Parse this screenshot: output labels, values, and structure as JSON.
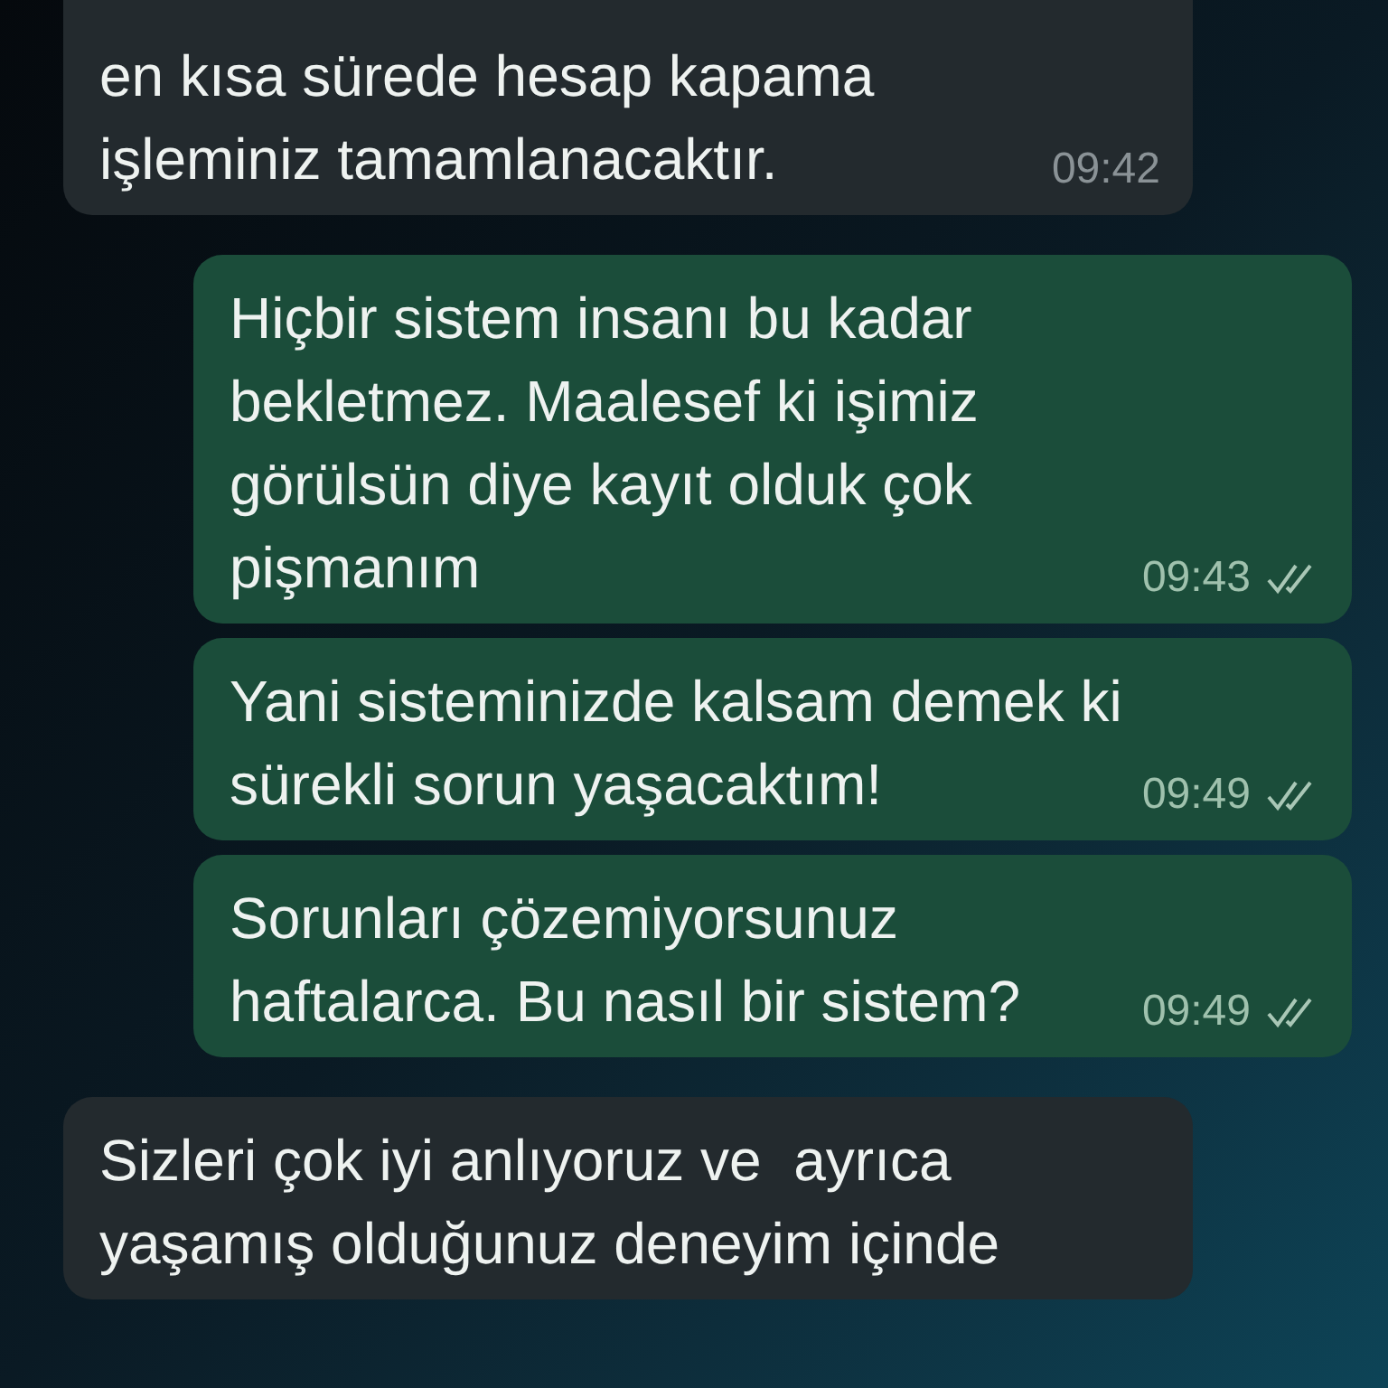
{
  "messages": [
    {
      "kind": "incoming",
      "text": "en kısa sürede hesap kapama\nişleminiz tamamlanacaktır.",
      "time": "09:42"
    },
    {
      "kind": "outgoing",
      "text": "Hiçbir sistem insanı bu kadar\nbekletmez. Maalesef ki işimiz\ngörülsün diye kayıt olduk çok\npişmanım",
      "time": "09:43",
      "delivered": true
    },
    {
      "kind": "outgoing",
      "text": "Yani sisteminizde kalsam demek ki\nsürekli sorun yaşacaktım!",
      "time": "09:49",
      "delivered": true
    },
    {
      "kind": "outgoing",
      "text": "Sorunları çözemiyorsunuz\nhaftalarca. Bu nasıl bir sistem?",
      "time": "09:49",
      "delivered": true
    },
    {
      "kind": "incoming",
      "text": "Sizleri çok iyi anlıyoruz ve  ayrıca\nyaşamış olduğunuz deneyim içinde"
    }
  ]
}
